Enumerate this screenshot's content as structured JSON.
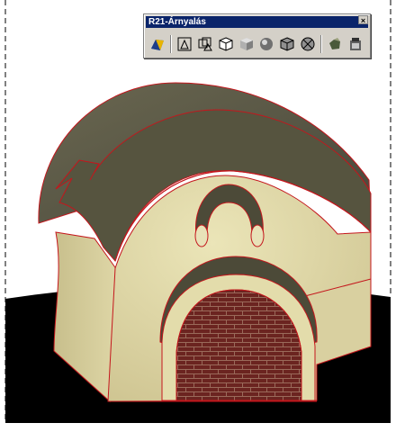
{
  "toolbar": {
    "title": "R21-Árnyalás",
    "close_label": "×",
    "buttons": [
      {
        "icon": "shade-icon"
      },
      {
        "icon": "2d-wireframe-icon"
      },
      {
        "icon": "3d-wireframe-icon"
      },
      {
        "icon": "hidden-icon"
      },
      {
        "icon": "flat-shaded-icon"
      },
      {
        "icon": "gouraud-shaded-icon"
      },
      {
        "icon": "flat-edges-on-icon"
      },
      {
        "icon": "gouraud-edges-on-icon"
      },
      {
        "icon": "render-icon"
      },
      {
        "icon": "render-settings-icon"
      }
    ]
  },
  "colors": {
    "roof": "#56543f",
    "wall": "#ddd6a5",
    "brick": "#6a241f",
    "edge": "#c4161c",
    "ground": "#000000",
    "titlebar": "#0a246a",
    "toolbar_bg": "#d4d0c8"
  }
}
